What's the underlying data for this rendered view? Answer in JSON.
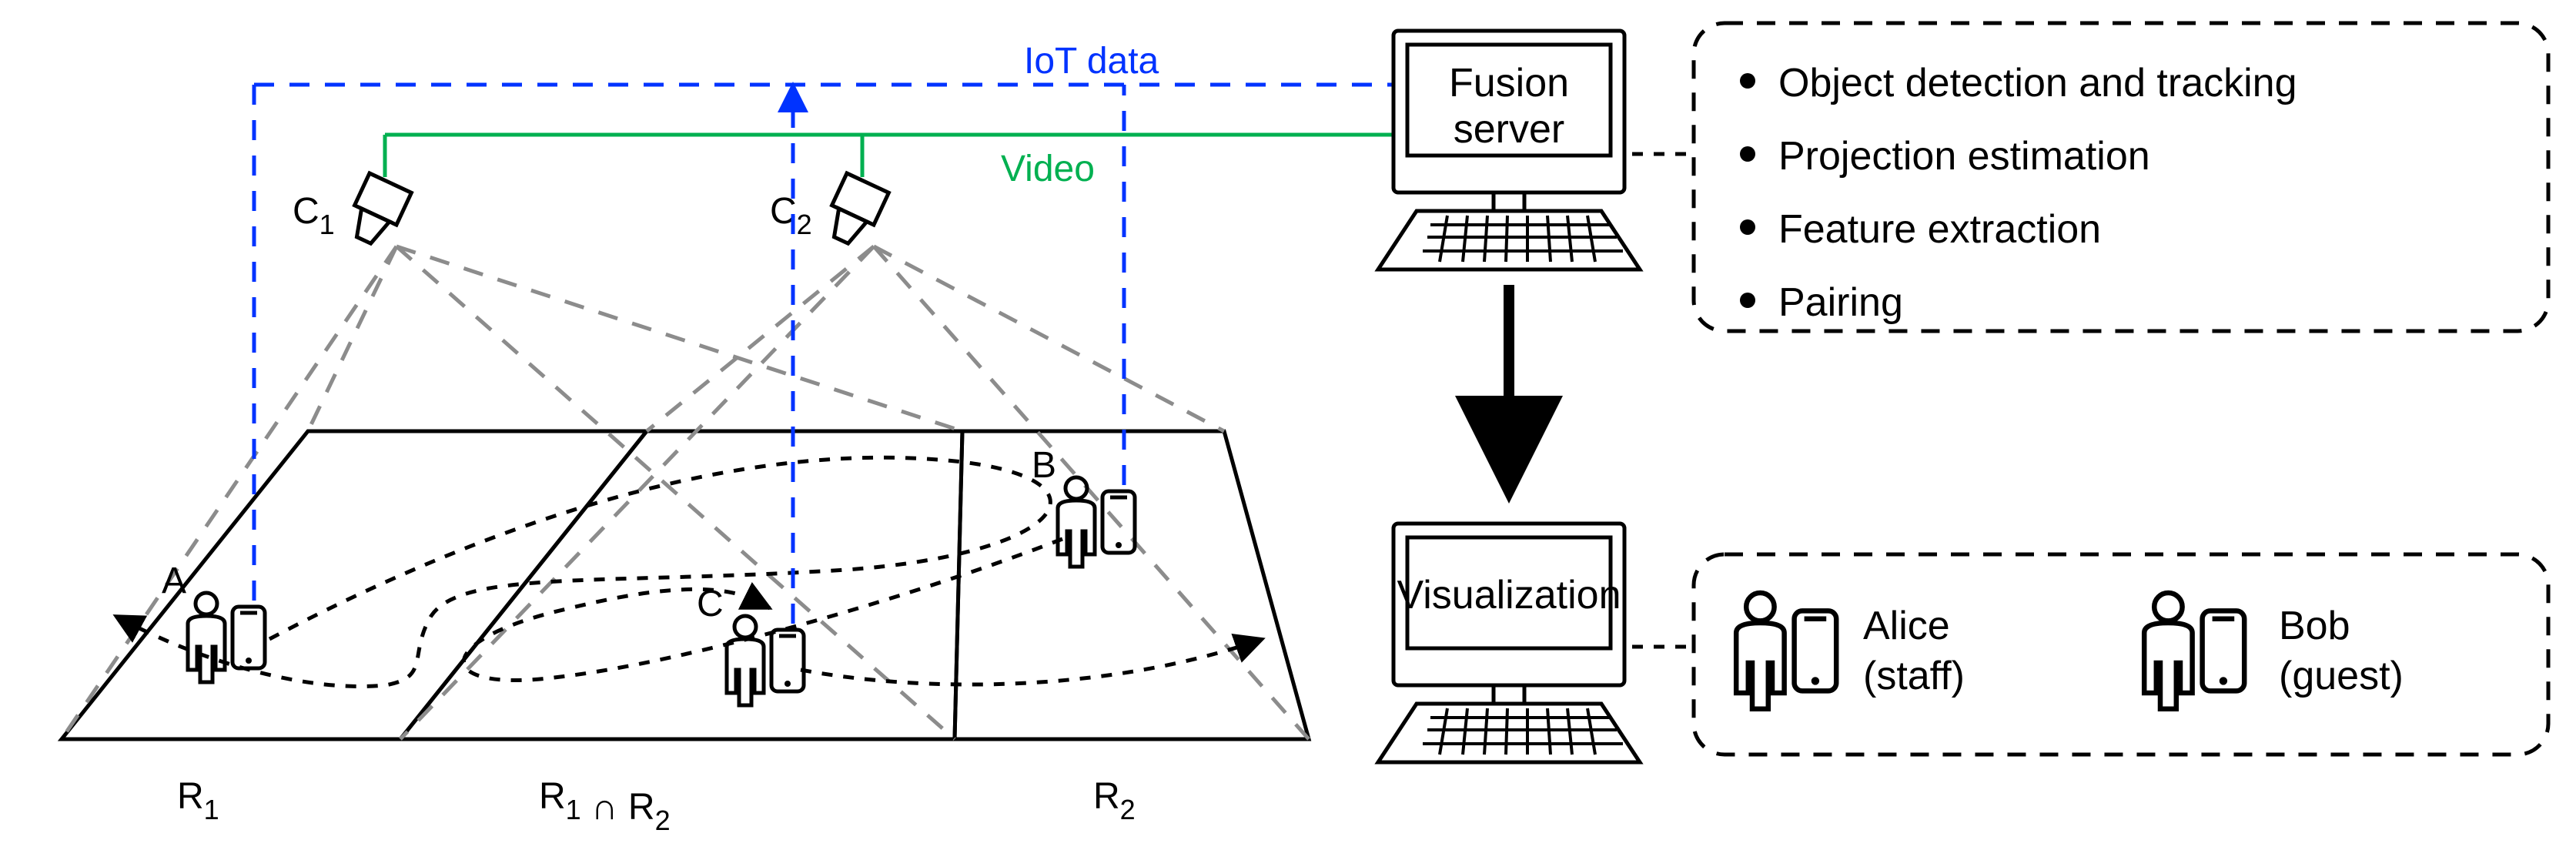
{
  "labels": {
    "iot": "IoT data",
    "video": "Video",
    "c1": "C",
    "c1sub": "1",
    "c2": "C",
    "c2sub": "2",
    "r1": "R",
    "r1sub": "1",
    "r1r2": "R",
    "r1r2sub1": "1",
    "inter": "∩",
    "r1r2b": "R",
    "r1r2sub2": "2",
    "r2": "R",
    "r2sub": "2",
    "pA": "A",
    "pB": "B",
    "pC": "C"
  },
  "fusion": {
    "title1": "Fusion",
    "title2": "server",
    "list": [
      "Object detection and tracking",
      "Projection estimation",
      "Feature extraction",
      "Pairing"
    ]
  },
  "viz": {
    "title": "Visualization",
    "alice1": "Alice",
    "alice2": "(staff)",
    "bob1": "Bob",
    "bob2": "(guest)"
  }
}
